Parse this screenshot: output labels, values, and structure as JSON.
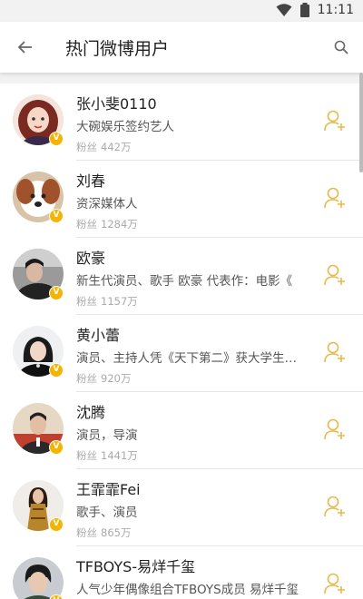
{
  "status": {
    "time": "11:11",
    "icons": [
      "wifi-icon",
      "battery-icon"
    ]
  },
  "header": {
    "title": "热门微博用户",
    "back_icon": "arrow-left-icon",
    "search_icon": "search-icon"
  },
  "colors": {
    "accent": "#f5b400",
    "follow": "#e8b94a"
  },
  "users": [
    {
      "name": "张小斐0110",
      "desc": "大碗娱乐签约艺人",
      "fans_label": "粉丝",
      "fans": "442万",
      "verified": true
    },
    {
      "name": "刘春",
      "desc": "资深媒体人",
      "fans_label": "粉丝",
      "fans": "1284万",
      "verified": true
    },
    {
      "name": "欧豪",
      "desc": "新生代演员、歌手 欧豪 代表作：电影《",
      "fans_label": "粉丝",
      "fans": "1157万",
      "verified": true
    },
    {
      "name": "黄小蕾",
      "desc": "演员、主持人凭《天下第二》获大学生…",
      "fans_label": "粉丝",
      "fans": "920万",
      "verified": true
    },
    {
      "name": "沈腾",
      "desc": "演员，导演",
      "fans_label": "粉丝",
      "fans": "1441万",
      "verified": true
    },
    {
      "name": "王霏霏Fei",
      "desc": "歌手、演员",
      "fans_label": "粉丝",
      "fans": "865万",
      "verified": true
    },
    {
      "name": "TFBOYS-易烊千玺",
      "desc": "人气少年偶像组合TFBOYS成员 易烊千玺",
      "fans_label": "粉丝",
      "fans": "",
      "verified": true
    }
  ]
}
